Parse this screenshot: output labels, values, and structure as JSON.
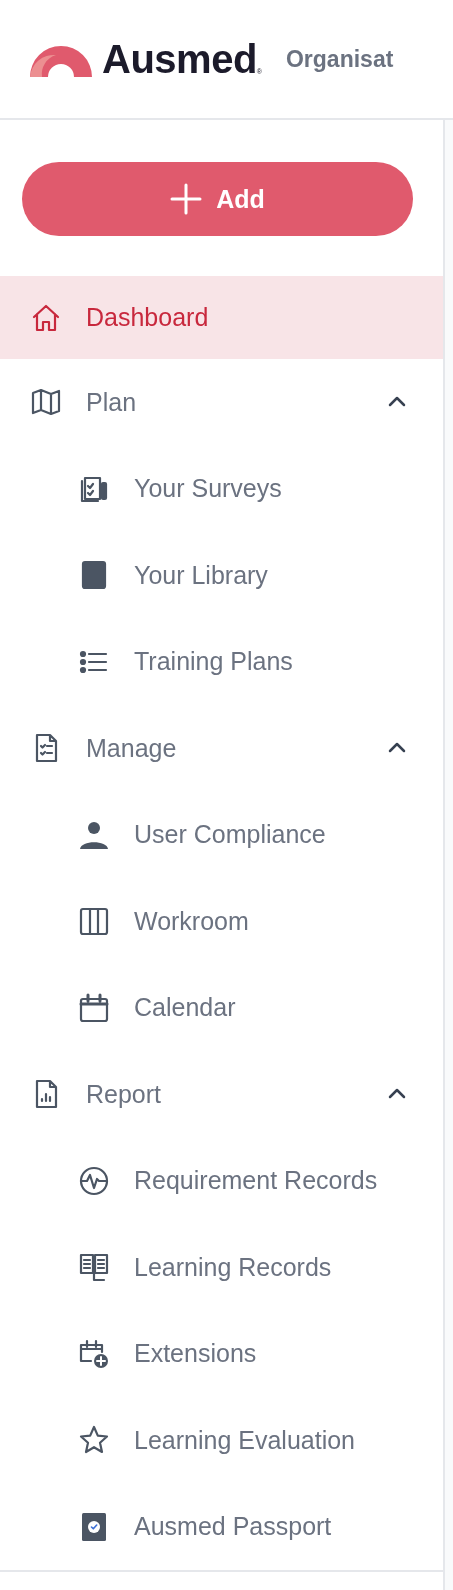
{
  "header": {
    "logo": {
      "text": "Ausmed",
      "mark": "®"
    },
    "nav": [
      {
        "label": "Organisat"
      }
    ]
  },
  "add_button": {
    "label": "Add"
  },
  "nav": [
    {
      "label": "Dashboard",
      "selected": true
    },
    {
      "label": "Plan",
      "selected": false,
      "expanded": true,
      "children": [
        {
          "label": "Your Surveys",
          "selected": false
        },
        {
          "label": "Your Library",
          "selected": false
        },
        {
          "label": "Training Plans",
          "selected": false
        }
      ]
    },
    {
      "label": "Manage",
      "selected": false,
      "expanded": true,
      "children": [
        {
          "label": "User Compliance",
          "selected": false
        },
        {
          "label": "Workroom",
          "selected": false
        },
        {
          "label": "Calendar",
          "selected": false
        }
      ]
    },
    {
      "label": "Report",
      "selected": false,
      "expanded": true,
      "children": [
        {
          "label": "Requirement Records",
          "selected": false
        },
        {
          "label": "Learning Records",
          "selected": false
        },
        {
          "label": "Extensions",
          "selected": false
        },
        {
          "label": "Learning Evaluation",
          "selected": false
        },
        {
          "label": "Ausmed Passport",
          "selected": false
        }
      ]
    }
  ]
}
